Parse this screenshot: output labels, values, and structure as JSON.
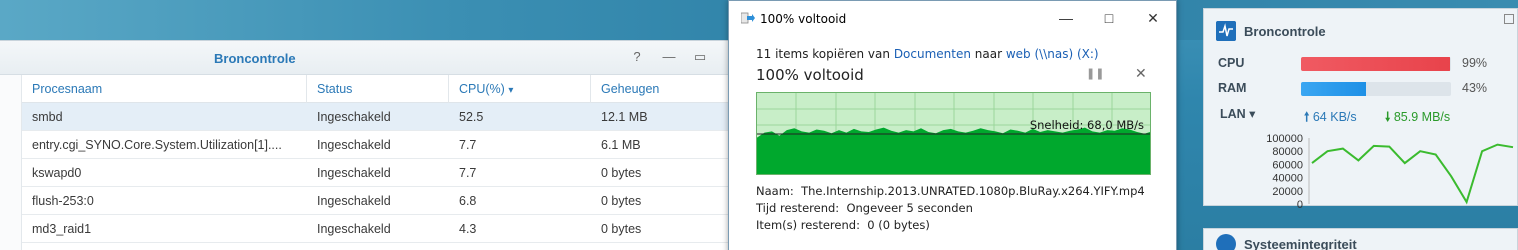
{
  "resource_monitor": {
    "title": "Broncontrole",
    "title_buttons": [
      "?",
      "—",
      "▭"
    ],
    "columns": [
      "Procesnaam",
      "Status",
      "CPU(%)",
      "Geheugen"
    ],
    "sort_indicator": "▾",
    "rows": [
      {
        "name": "smbd",
        "status": "Ingeschakeld",
        "cpu": "52.5",
        "memory": "12.1 MB"
      },
      {
        "name": "entry.cgi_SYNO.Core.System.Utilization[1]....",
        "status": "Ingeschakeld",
        "cpu": "7.7",
        "memory": "6.1 MB"
      },
      {
        "name": "kswapd0",
        "status": "Ingeschakeld",
        "cpu": "7.7",
        "memory": "0 bytes"
      },
      {
        "name": "flush-253:0",
        "status": "Ingeschakeld",
        "cpu": "6.8",
        "memory": "0 bytes"
      },
      {
        "name": "md3_raid1",
        "status": "Ingeschakeld",
        "cpu": "4.3",
        "memory": "0 bytes"
      }
    ]
  },
  "copy_dialog": {
    "title": "100% voltooid",
    "line_prefix": "11 items kopiëren van ",
    "source": "Documenten",
    "line_mid": " naar ",
    "destination": "web (\\\\nas) (X:)",
    "percent_text": "100% voltooid",
    "speed": "Snelheid: 68,0 MB/s",
    "speed_profile": [
      62,
      70,
      72,
      65,
      74,
      77,
      72,
      70,
      75,
      73,
      69,
      74,
      70,
      76,
      72,
      71,
      75,
      78,
      73,
      70,
      74,
      72,
      77,
      71,
      69,
      74,
      76,
      72,
      70,
      73,
      77,
      74,
      72,
      69,
      75,
      73,
      70,
      76,
      71,
      74,
      72,
      70,
      73,
      75,
      78,
      72,
      70,
      74,
      73,
      77,
      75,
      71,
      68,
      72
    ],
    "name_label": "Naam:",
    "name_value": "The.Internship.2013.UNRATED.1080p.BluRay.x264.YIFY.mp4",
    "time_label": "Tijd resterend:",
    "time_value": "Ongeveer 5 seconden",
    "items_label": "Item(s) resterend:",
    "items_value": "0 (0 bytes)",
    "accent_color": "#00a82d"
  },
  "widget": {
    "title": "Broncontrole",
    "cpu_label": "CPU",
    "cpu_pct": "99%",
    "cpu_level": 0.99,
    "ram_label": "RAM",
    "ram_pct": "43%",
    "ram_level": 0.43,
    "lan_label": "LAN ▾",
    "lan_up": "64 KB/s",
    "lan_down": "85.9 MB/s",
    "y_ticks": [
      "100000",
      "80000",
      "60000",
      "40000",
      "20000",
      "0"
    ],
    "chart_series": [
      62000,
      80000,
      84000,
      66000,
      88000,
      87000,
      62000,
      80000,
      75000,
      42000,
      3000,
      80000,
      90000,
      86000
    ],
    "second_title": "Systeemintegriteit",
    "cpu_color": "#e8434b",
    "ram_color": "#1e90e6",
    "line_color": "#3bbb2f"
  }
}
